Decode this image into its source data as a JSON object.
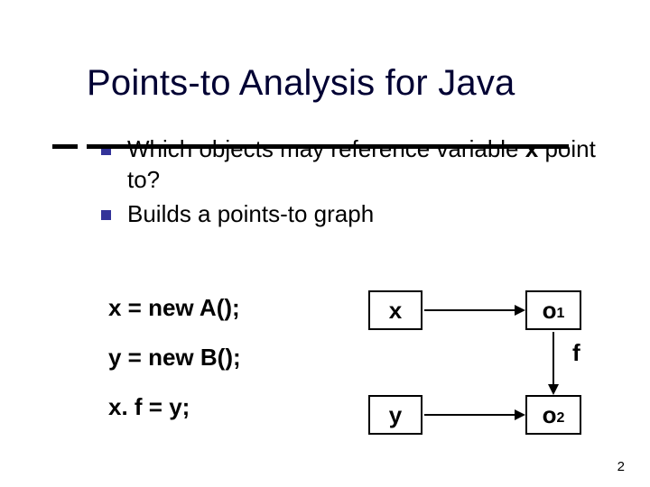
{
  "title": "Points-to Analysis for Java",
  "bullets": {
    "b1_pre": "Which objects may reference variable ",
    "b1_var": "x",
    "b1_post": " point to?",
    "b2": "Builds a points-to graph"
  },
  "code": {
    "l1": "x = new A();",
    "l2": "y = new B();",
    "l3": "x. f = y;"
  },
  "nodes": {
    "x": "x",
    "y": "y",
    "o1_base": "o",
    "o1_sub": "1",
    "o2_base": "o",
    "o2_sub": "2"
  },
  "edge_label_f": "f",
  "page_number": "2"
}
